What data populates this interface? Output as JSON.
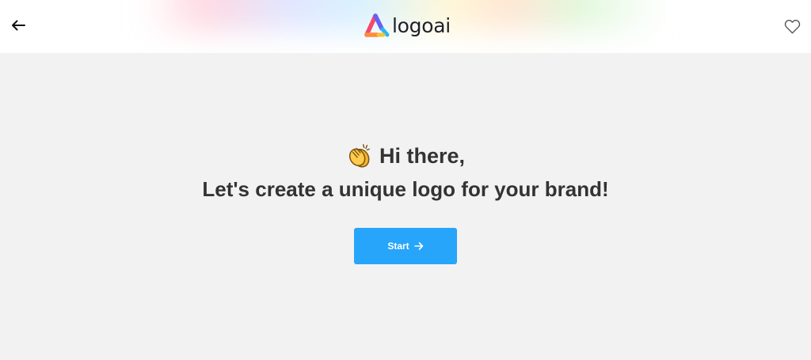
{
  "header": {
    "back_icon": "arrow-left-icon",
    "logo_text": "logoai",
    "favorite_icon": "heart-outline-icon"
  },
  "main": {
    "greeting_icon": "clapping-hands-icon",
    "greeting": "Hi there,",
    "subtitle": "Let's create a unique logo for your brand!",
    "start_label": "Start",
    "start_icon": "arrow-right-icon"
  },
  "colors": {
    "accent": "#26a5fb",
    "text": "#333333",
    "background": "#f2f2f2",
    "header_background": "#ffffff"
  }
}
